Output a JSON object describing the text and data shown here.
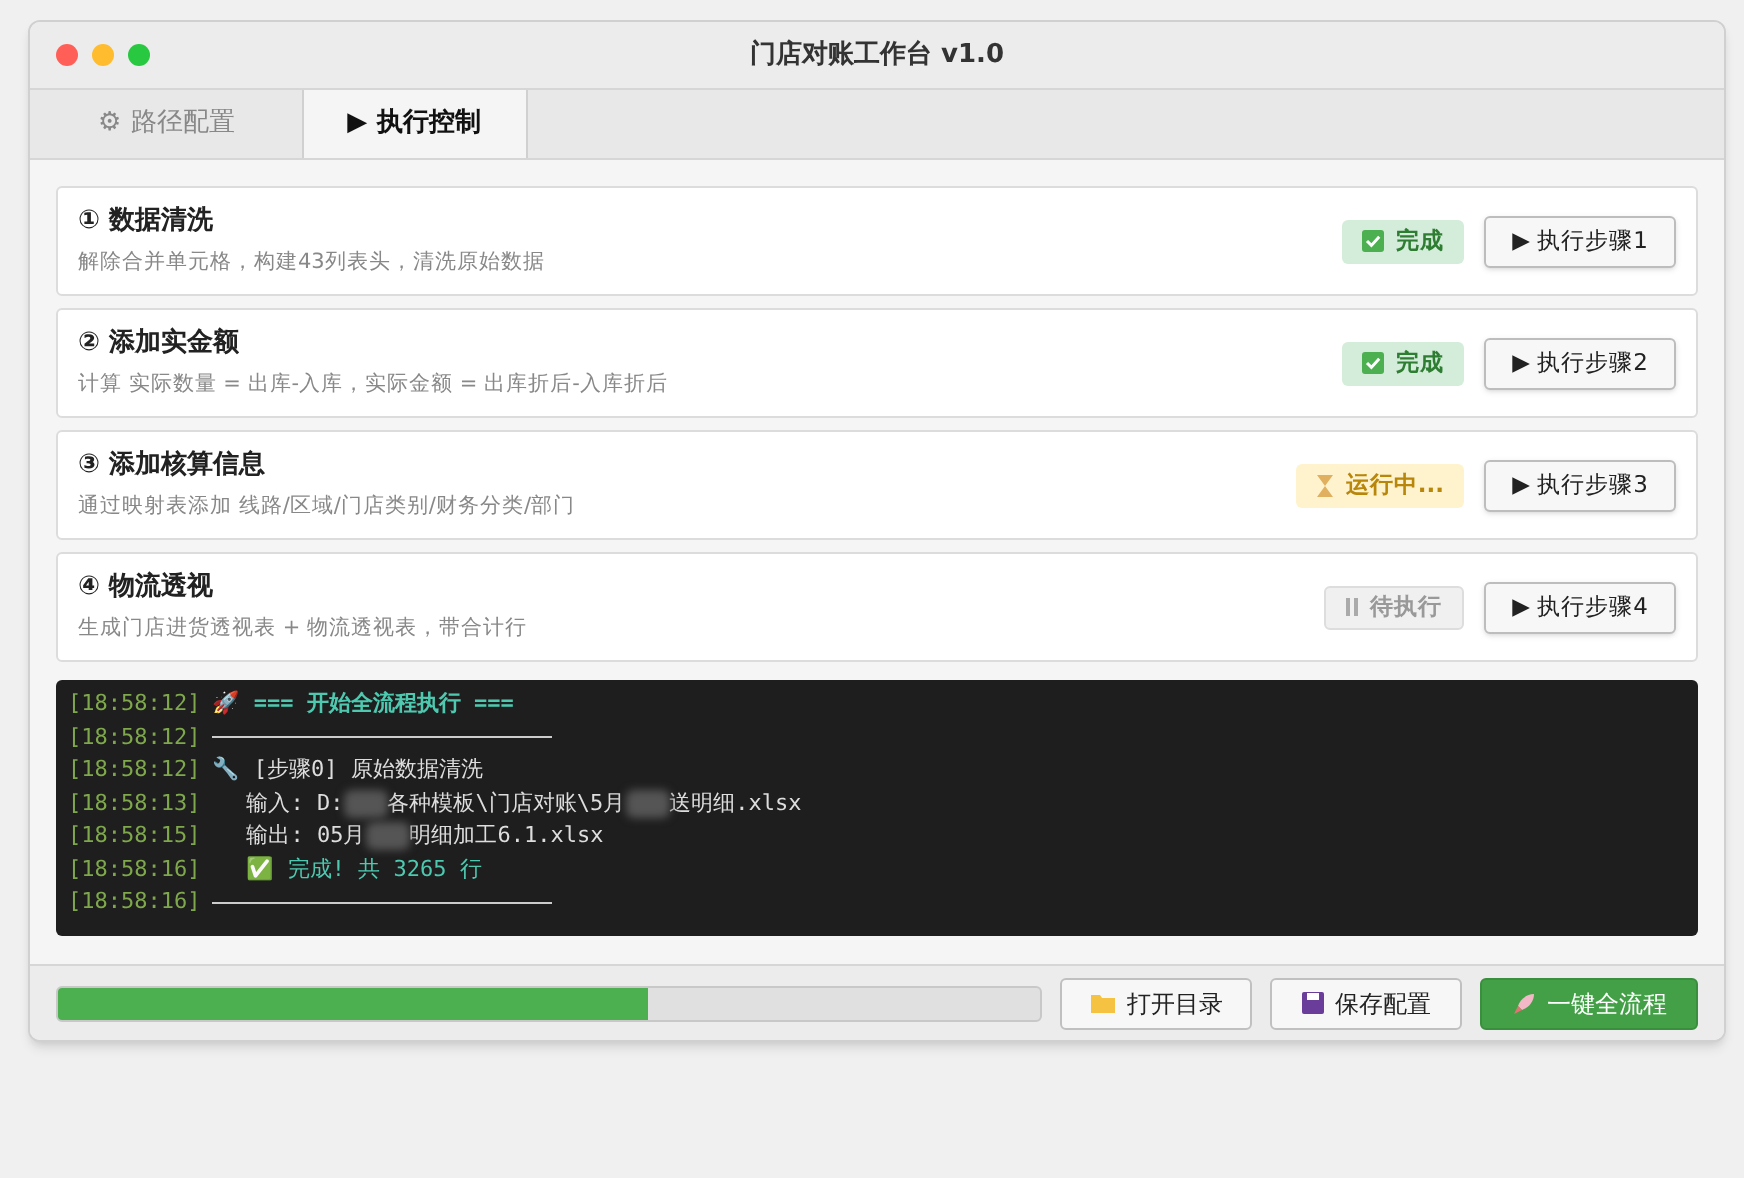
{
  "window": {
    "title": "门店对账工作台 v1.0"
  },
  "tabs": [
    {
      "icon": "⚙",
      "label": "路径配置",
      "selected": false
    },
    {
      "icon": "▶",
      "label": "执行控制",
      "selected": true
    }
  ],
  "steps": [
    {
      "title": "① 数据清洗",
      "description": "解除合并单元格，构建43列表头，清洗原始数据",
      "status": {
        "kind": "done",
        "label": "完成"
      },
      "button": "▶ 执行步骤1"
    },
    {
      "title": "② 添加实金额",
      "description": "计算 实际数量 = 出库-入库，实际金额 = 出库折后-入库折后",
      "status": {
        "kind": "done",
        "label": "完成"
      },
      "button": "▶ 执行步骤2"
    },
    {
      "title": "③ 添加核算信息",
      "description": "通过映射表添加 线路/区域/门店类别/财务分类/部门",
      "status": {
        "kind": "running",
        "label": "运行中..."
      },
      "button": "▶ 执行步骤3"
    },
    {
      "title": "④ 物流透视",
      "description": "生成门店进货透视表 + 物流透视表，带合计行",
      "status": {
        "kind": "pending",
        "label": "待执行"
      },
      "button": "▶ 执行步骤4"
    }
  ],
  "log": [
    {
      "time": "[18:58:12]",
      "kind": "header",
      "parts": [
        "🚀 === 开始全流程执行 ==="
      ]
    },
    {
      "time": "[18:58:12]",
      "kind": "rule"
    },
    {
      "time": "[18:58:12]",
      "kind": "step",
      "parts": [
        "🔧 [步骤0] 原始数据清洗"
      ]
    },
    {
      "time": "[18:58:13]",
      "kind": "info",
      "parts": [
        "输入: D:",
        "各种模板\\门店对账\\5月",
        "送明细.xlsx"
      ]
    },
    {
      "time": "[18:58:15]",
      "kind": "info",
      "parts": [
        "输出: 05月",
        "明细加工6.1.xlsx"
      ]
    },
    {
      "time": "[18:58:16]",
      "kind": "success",
      "parts": [
        "✅ 完成! 共 3265 行"
      ]
    },
    {
      "time": "[18:58:16]",
      "kind": "rule"
    }
  ],
  "progress": {
    "level": 0.6
  },
  "buttons": [
    {
      "kind": "folder",
      "label": "打开目录"
    },
    {
      "kind": "save",
      "label": "保存配置"
    },
    {
      "kind": "run",
      "label": "一键全流程"
    }
  ]
}
